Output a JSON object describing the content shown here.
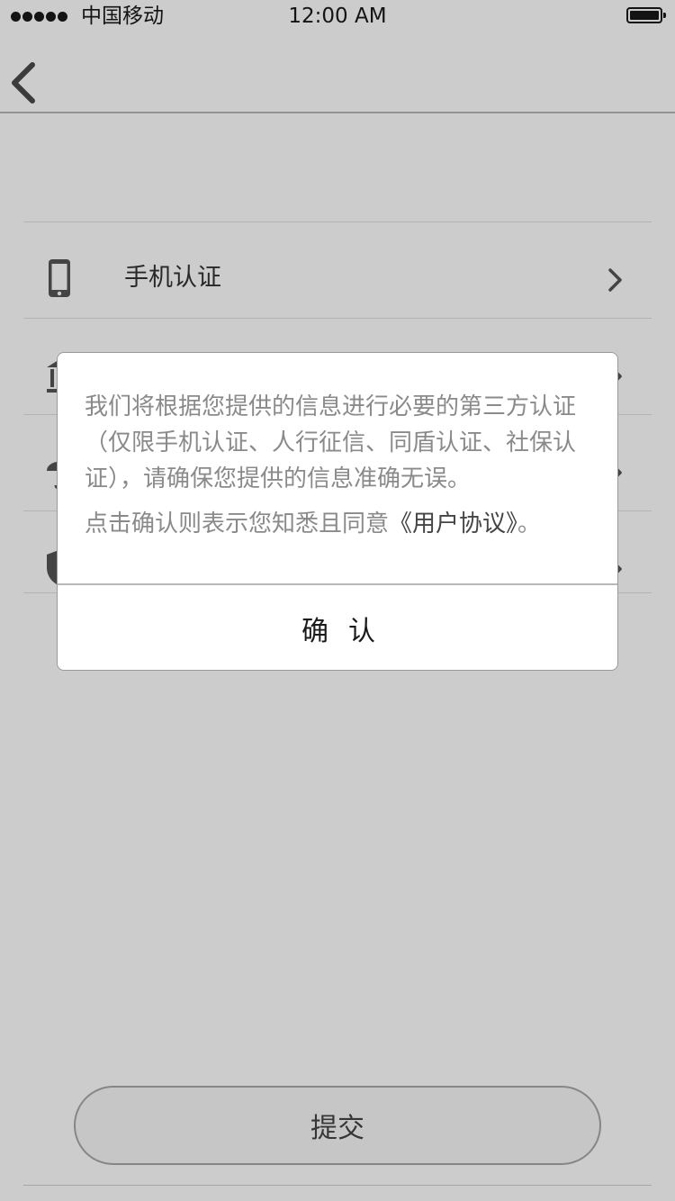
{
  "status_bar": {
    "carrier": "中国移动",
    "time": "12:00 AM",
    "signal_bars": 5
  },
  "nav": {
    "back_icon": "chevron-left-icon"
  },
  "list": {
    "items": [
      {
        "label": "手机认证",
        "icon": "phone-icon"
      },
      {
        "label": "",
        "icon": "bank-icon"
      },
      {
        "label": "",
        "icon": "umbrella-icon"
      },
      {
        "label": "",
        "icon": "shield-icon"
      }
    ]
  },
  "submit": {
    "label": "提交"
  },
  "dialog": {
    "message": "我们将根据您提供的信息进行必要的第三方认证（仅限手机认证、人行征信、同盾认证、社保认证），请确保您提供的信息准确无误。",
    "agreement_prefix": "点击确认则表示您知悉且同意",
    "agreement_link": "《用户协议》",
    "agreement_suffix": "。",
    "confirm_label": "确认"
  },
  "colors": {
    "overlay": "rgba(0,0,0,0.2)",
    "text_gray": "#8a8a8a",
    "text_dark": "#1a1a1a"
  }
}
